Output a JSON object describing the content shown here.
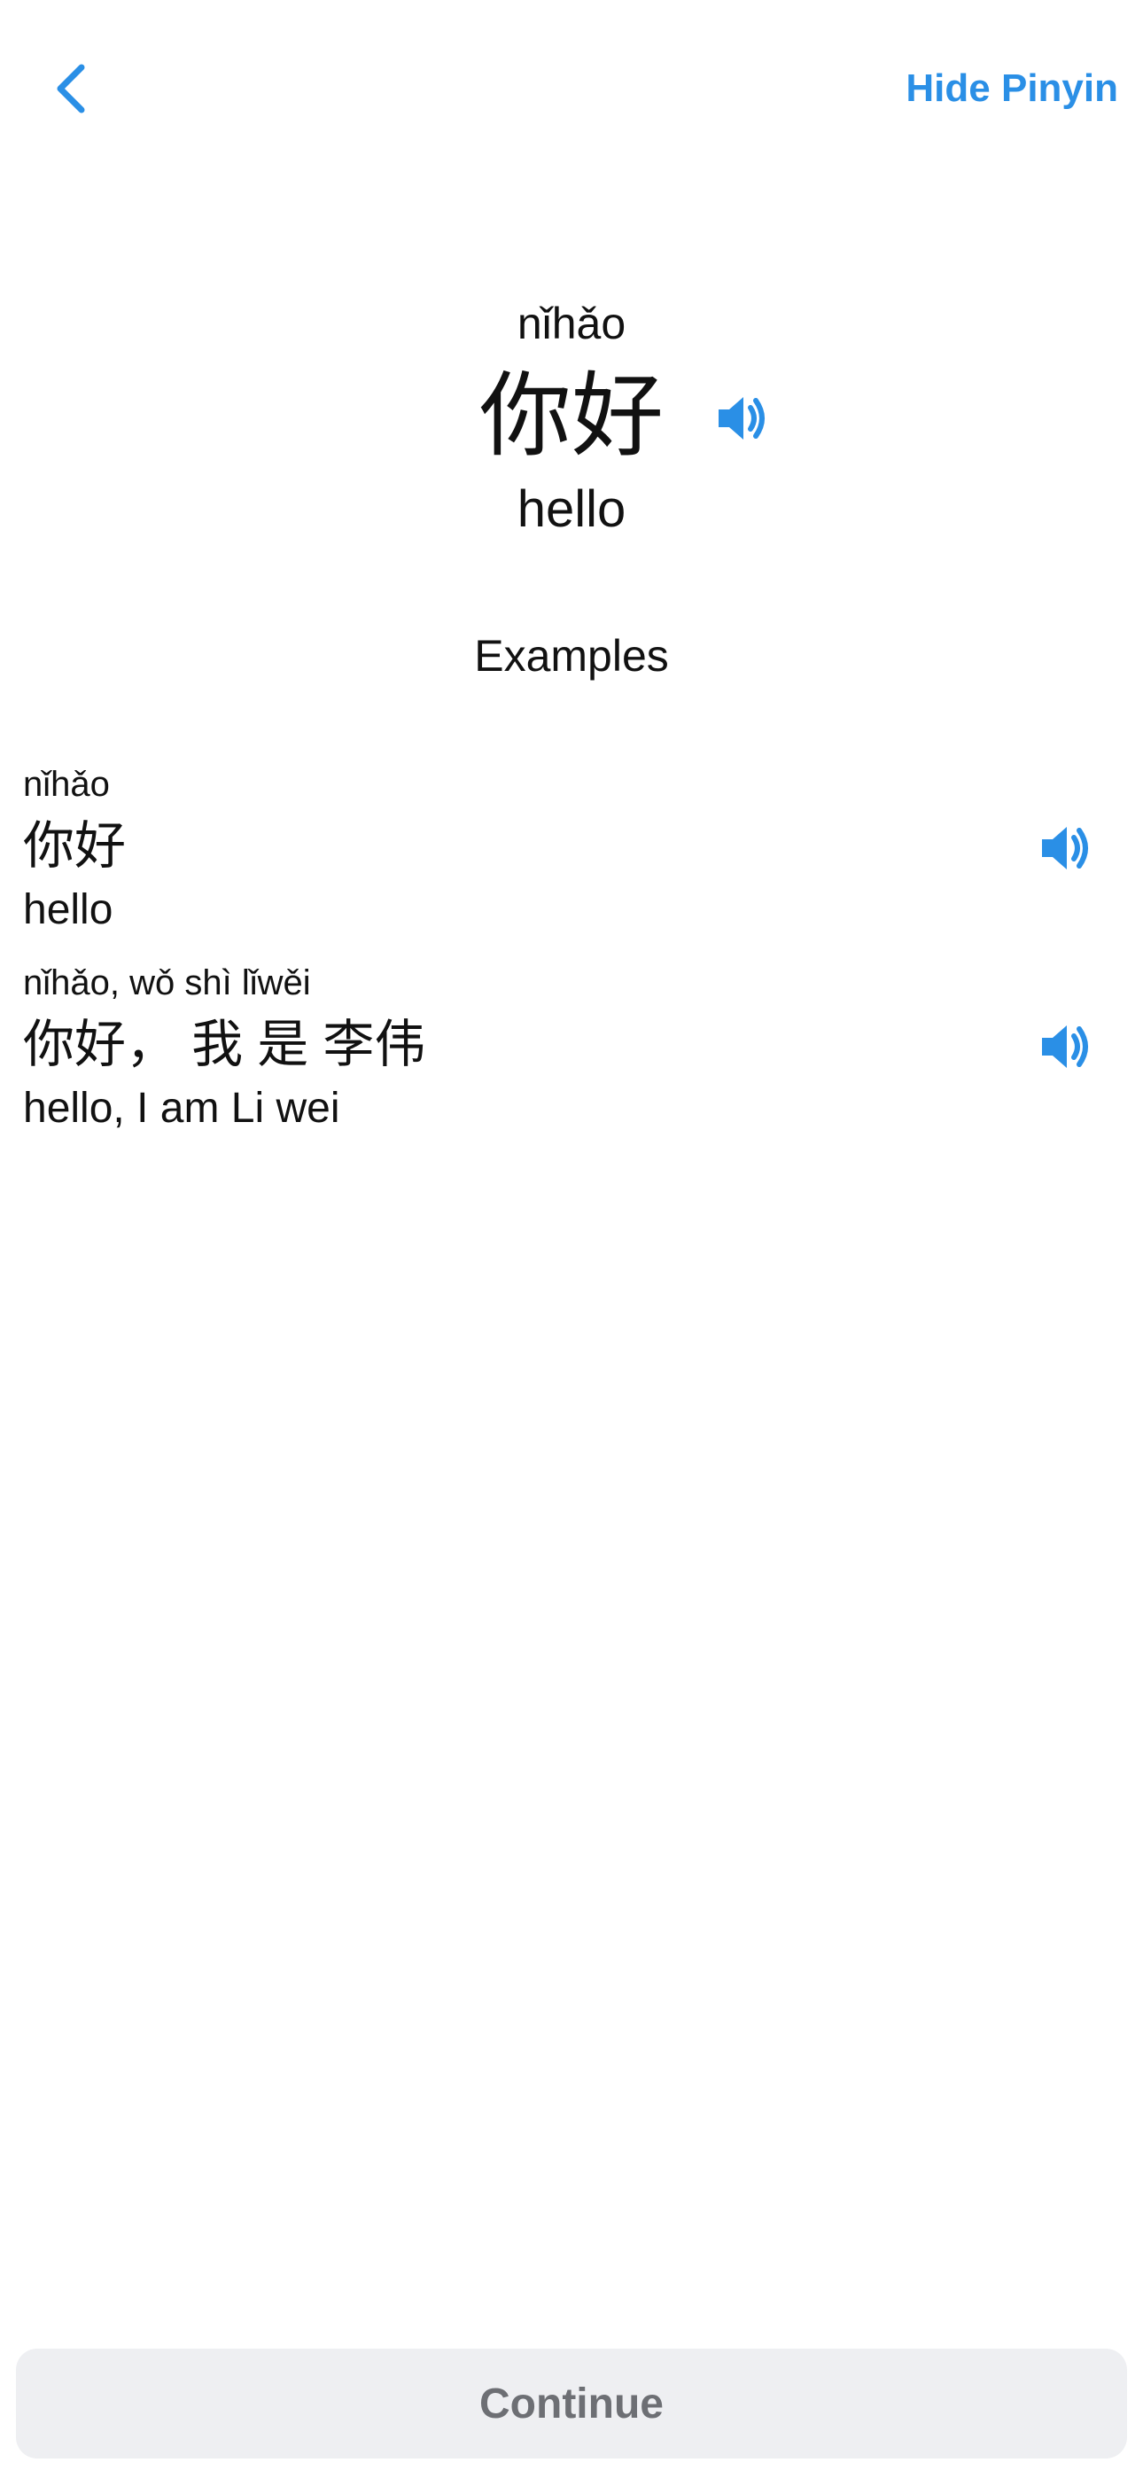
{
  "header": {
    "back_icon": "chevron-left-icon",
    "hide_pinyin_label": "Hide Pinyin",
    "accent_color": "#2a8fe6"
  },
  "word": {
    "pinyin": "nǐhǎo",
    "hanzi": "你好",
    "meaning": "hello",
    "audio_icon": "speaker-icon"
  },
  "examples": {
    "title": "Examples",
    "items": [
      {
        "pinyin": "nǐhǎo",
        "hanzi": "你好",
        "meaning": "hello",
        "audio_icon": "speaker-icon"
      },
      {
        "pinyin": "nǐhǎo, wǒ shì lǐwěi",
        "hanzi": "你好， 我 是 李伟",
        "meaning": "hello, I am Li wei",
        "audio_icon": "speaker-icon"
      }
    ]
  },
  "footer": {
    "continue_label": "Continue",
    "continue_bg": "#eeeff2",
    "continue_text_color": "#6d6f74"
  }
}
